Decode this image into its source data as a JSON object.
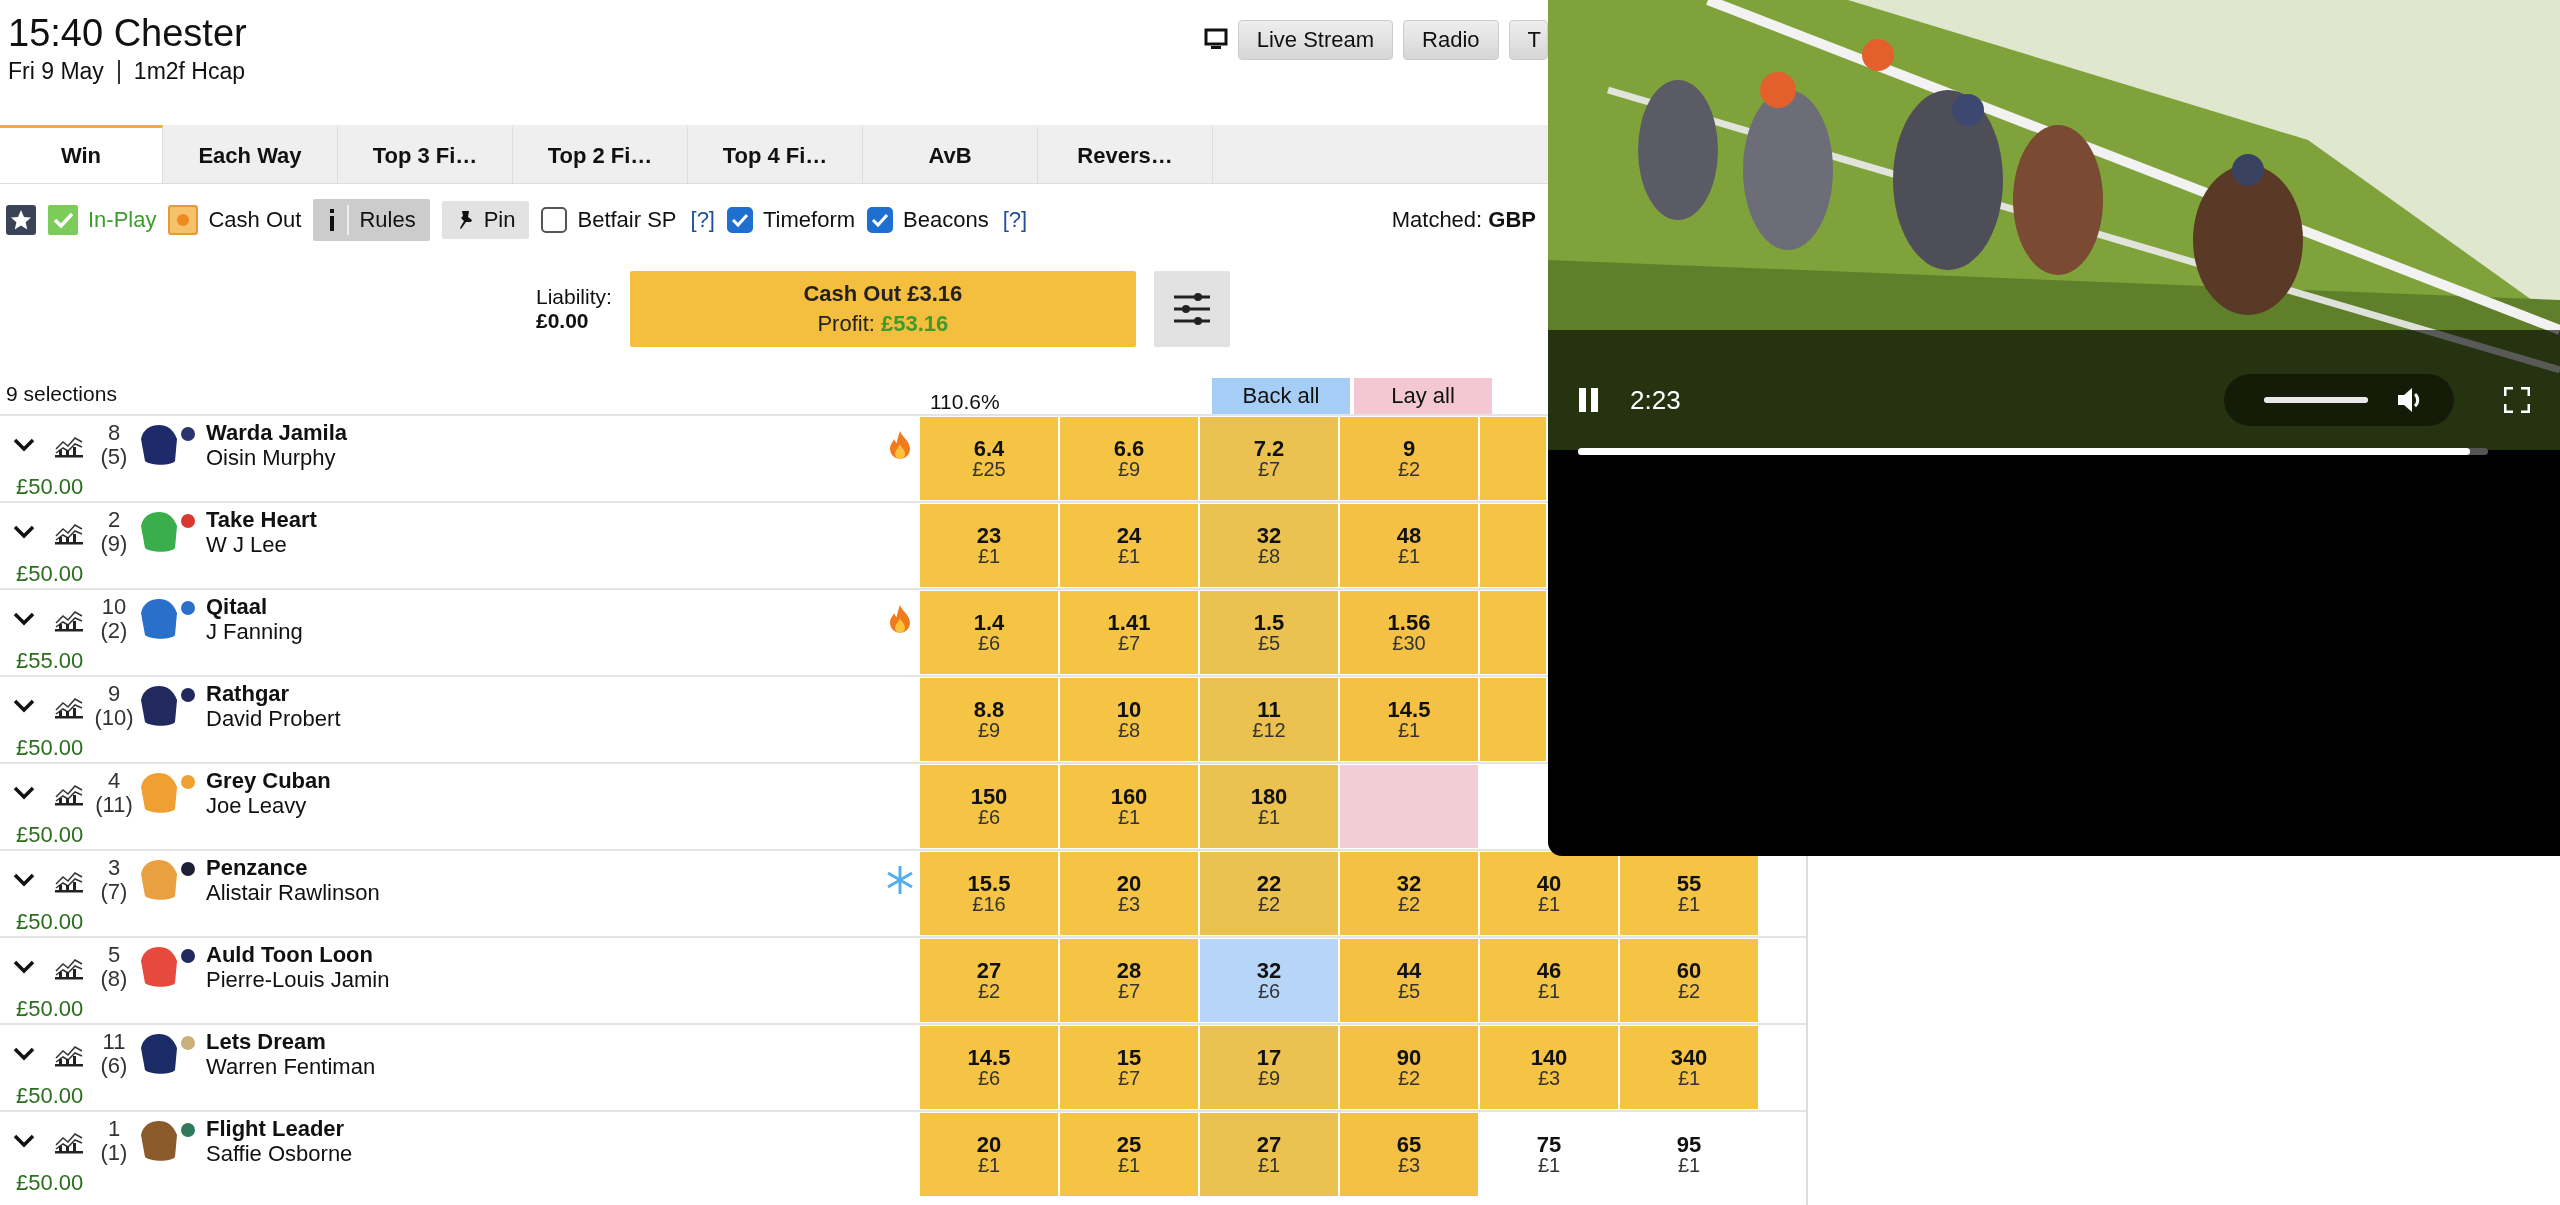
{
  "race": {
    "title": "15:40 Chester",
    "date": "Fri 9 May",
    "race_type": "1m2f Hcap"
  },
  "header_buttons": [
    "Live Stream",
    "Radio",
    "T"
  ],
  "tabs": [
    {
      "label": "Win",
      "selected": true
    },
    {
      "label": "Each Way",
      "selected": false
    },
    {
      "label": "Top 3 Fi…",
      "selected": false
    },
    {
      "label": "Top 2 Fi…",
      "selected": false
    },
    {
      "label": "Top 4 Fi…",
      "selected": false
    },
    {
      "label": "AvB",
      "selected": false
    },
    {
      "label": "Revers…",
      "selected": false
    }
  ],
  "filters": {
    "in_play": {
      "label": "In-Play",
      "on": true
    },
    "cash_out": {
      "label": "Cash Out"
    },
    "rules": "Rules",
    "pin": "Pin",
    "checks": [
      {
        "label": "Betfair SP",
        "checked": false,
        "help": "[?]"
      },
      {
        "label": "Timeform",
        "checked": true
      },
      {
        "label": "Beacons",
        "checked": true,
        "help": "[?]"
      }
    ]
  },
  "matched": "Matched: **GBP**",
  "liability": {
    "label": "Liability:",
    "value": "£0.00"
  },
  "cash_out_button": {
    "title": "Cash Out £3.16",
    "profit_label": "Profit:",
    "profit_value": "£53.16"
  },
  "selections_count": "9 selections",
  "book_percent": "110.6%",
  "back_all": "Back all",
  "lay_all": "Lay all",
  "runners": [
    {
      "number": "8",
      "draw": "(5)",
      "name": "Warda Jamila",
      "jockey": "Oisin Murphy",
      "stake": "£50.00",
      "color": "#1f2a6b",
      "cap": {
        "color": "#2a3570"
      },
      "badge": {
        "kind": "fire"
      },
      "prices": [
        {
          "price": "6.4",
          "stake": "£25",
          "color": "#f5c444"
        },
        {
          "price": "6.6",
          "stake": "£9",
          "color": "#f5c444"
        },
        {
          "price": "7.2",
          "stake": "£7",
          "color": "#ebc150"
        },
        {
          "price": "9",
          "stake": "£2",
          "color": "#f4c145"
        },
        {
          "color": "#f5c444"
        }
      ]
    },
    {
      "number": "2",
      "draw": "(9)",
      "name": "Take Heart",
      "jockey": "W J Lee",
      "stake": "£50.00",
      "color": "#3aae4a",
      "cap": {
        "color": "#d8382f"
      },
      "prices": [
        {
          "price": "23",
          "stake": "£1",
          "color": "#f5c444"
        },
        {
          "price": "24",
          "stake": "£1",
          "color": "#f5c444"
        },
        {
          "price": "32",
          "stake": "£8",
          "color": "#ebc150"
        },
        {
          "price": "48",
          "stake": "£1",
          "color": "#f4c145"
        },
        {
          "color": "#f5c444"
        }
      ]
    },
    {
      "number": "10",
      "draw": "(2)",
      "name": "Qitaal",
      "jockey": "J Fanning",
      "stake": "£55.00",
      "color": "#2a6fc9",
      "cap": {
        "color": "#2a6fc9"
      },
      "badge": {
        "kind": "fire"
      },
      "prices": [
        {
          "price": "1.4",
          "stake": "£6",
          "color": "#f5c444"
        },
        {
          "price": "1.41",
          "stake": "£7",
          "color": "#f5c444"
        },
        {
          "price": "1.5",
          "stake": "£5",
          "color": "#ebc150"
        },
        {
          "price": "1.56",
          "stake": "£30",
          "color": "#f4c145"
        },
        {
          "color": "#f5c444"
        }
      ]
    },
    {
      "number": "9",
      "draw": "(10)",
      "name": "Rathgar",
      "jockey": "David Probert",
      "stake": "£50.00",
      "color": "#22295e",
      "cap": {
        "color": "#22295e"
      },
      "prices": [
        {
          "price": "8.8",
          "stake": "£9",
          "color": "#f5c444"
        },
        {
          "price": "10",
          "stake": "£8",
          "color": "#f5c444"
        },
        {
          "price": "11",
          "stake": "£12",
          "color": "#ebc150"
        },
        {
          "price": "14.5",
          "stake": "£1",
          "color": "#f4c145"
        },
        {
          "color": "#f5c444"
        }
      ]
    },
    {
      "number": "4",
      "draw": "(11)",
      "name": "Grey Cuban",
      "jockey": "Joe Leavy",
      "stake": "£50.00",
      "color": "#efa030",
      "cap": {
        "color": "#efa030"
      },
      "prices": [
        {
          "price": "150",
          "stake": "£6",
          "color": "#f5c444"
        },
        {
          "price": "160",
          "stake": "£1",
          "color": "#f5c444"
        },
        {
          "price": "180",
          "stake": "£1",
          "color": "#ebc150"
        },
        {
          "color": "#f2cdd6"
        }
      ]
    },
    {
      "number": "3",
      "draw": "(7)",
      "name": "Penzance",
      "jockey": "Alistair Rawlinson",
      "stake": "£50.00",
      "color": "#e9a040",
      "cap": {
        "color": "#1d2035"
      },
      "badge": {
        "kind": "snowflake"
      },
      "prices": [
        {
          "price": "15.5",
          "stake": "£16",
          "color": "#f5c444"
        },
        {
          "price": "20",
          "stake": "£3",
          "color": "#f5c444"
        },
        {
          "price": "22",
          "stake": "£2",
          "color": "#ebc150"
        },
        {
          "price": "32",
          "stake": "£2",
          "color": "#f4c145"
        },
        {
          "price": "40",
          "stake": "£1",
          "color": "#f5c444"
        },
        {
          "price": "55",
          "stake": "£1",
          "color": "#f5c444"
        }
      ]
    },
    {
      "number": "5",
      "draw": "(8)",
      "name": "Auld Toon Loon",
      "jockey": "Pierre-Louis Jamin",
      "stake": "£50.00",
      "color": "#e54a3c",
      "cap": {
        "color": "#22295e"
      },
      "prices": [
        {
          "price": "27",
          "stake": "£2",
          "color": "#f5c444"
        },
        {
          "price": "28",
          "stake": "£7",
          "color": "#f5c444"
        },
        {
          "price": "32",
          "stake": "£6",
          "color": "#b6d5f8"
        },
        {
          "price": "44",
          "stake": "£5",
          "color": "#f4c145"
        },
        {
          "price": "46",
          "stake": "£1",
          "color": "#f5c444"
        },
        {
          "price": "60",
          "stake": "£2",
          "color": "#f5c444"
        }
      ]
    },
    {
      "number": "11",
      "draw": "(6)",
      "name": "Lets Dream",
      "jockey": "Warren Fentiman",
      "stake": "£50.00",
      "color": "#1b2b66",
      "cap": {
        "color": "#c9b07a"
      },
      "prices": [
        {
          "price": "14.5",
          "stake": "£6",
          "color": "#f5c444"
        },
        {
          "price": "15",
          "stake": "£7",
          "color": "#f5c444"
        },
        {
          "price": "17",
          "stake": "£9",
          "color": "#ebc150"
        },
        {
          "price": "90",
          "stake": "£2",
          "color": "#f4c145"
        },
        {
          "price": "140",
          "stake": "£3",
          "color": "#f5c444"
        },
        {
          "price": "340",
          "stake": "£1",
          "color": "#f5c444"
        }
      ]
    },
    {
      "number": "1",
      "draw": "(1)",
      "name": "Flight Leader",
      "jockey": "Saffie Osborne",
      "stake": "£50.00",
      "color": "#8a5a2b",
      "cap": {
        "color": "#2f7a5a"
      },
      "prices": [
        {
          "price": "20",
          "stake": "£1",
          "color": "#f5c444"
        },
        {
          "price": "25",
          "stake": "£1",
          "color": "#f5c444"
        },
        {
          "price": "27",
          "stake": "£1",
          "color": "#ebc150"
        },
        {
          "price": "65",
          "stake": "£3",
          "color": "#f4c145"
        },
        {
          "price": "75",
          "stake": "£1",
          "color": "#ffffff"
        },
        {
          "price": "95",
          "stake": "£1",
          "color": "#ffffff"
        }
      ]
    }
  ],
  "video": {
    "playing": true,
    "time": "2:23",
    "volume": {
      "level": 1
    },
    "progress": {
      "level": 0.98
    }
  }
}
